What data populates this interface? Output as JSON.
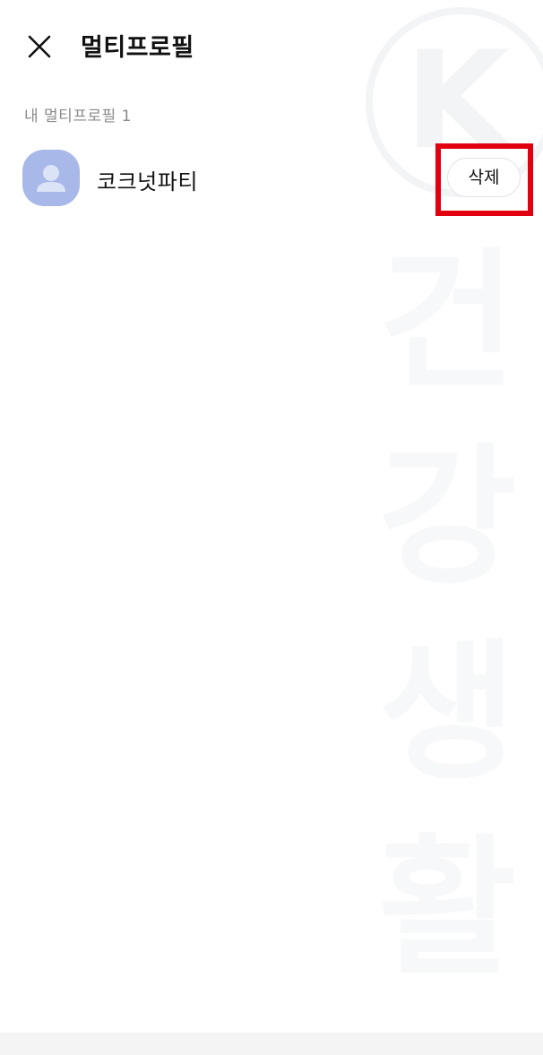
{
  "header": {
    "title": "멀티프로필",
    "close_icon": "close-icon"
  },
  "section": {
    "label": "내 멀티프로필 1"
  },
  "profiles": [
    {
      "name": "코크넛파티",
      "avatar_icon": "person-icon",
      "action_label": "삭제"
    }
  ],
  "watermark": {
    "logo_letter": "K",
    "text": "건강생활"
  },
  "colors": {
    "avatar_bg": "#a8b8e8",
    "highlight": "#e0000f",
    "section_label": "#8a8a8a"
  }
}
